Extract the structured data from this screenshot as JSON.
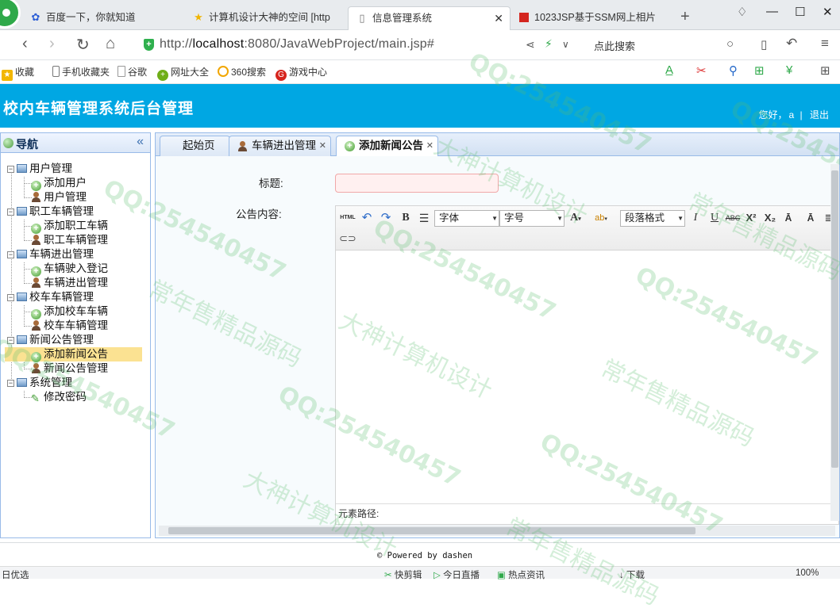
{
  "browser": {
    "tabs": [
      {
        "title": "百度一下，你就知道",
        "icon": "paw-icon"
      },
      {
        "title": "计算机设计大神的空间 [http",
        "icon": "star-icon"
      },
      {
        "title": "信息管理系统",
        "icon": "page-icon"
      },
      {
        "title": "1023JSP基于SSM网上相片",
        "icon": "red-square-icon"
      }
    ],
    "url_prefix": "http://",
    "url_host": "localhost",
    "url_rest": ":8080/JavaWebProject/main.jsp#",
    "search_label": "点此搜索",
    "bookmarks": [
      "收藏",
      "手机收藏夹",
      "谷歌",
      "网址大全",
      "360搜索",
      "游戏中心"
    ]
  },
  "app": {
    "title": "校内车辆管理系统后台管理",
    "greeting": "您好，",
    "user": "a",
    "separator": "|",
    "logout": "退出"
  },
  "nav": {
    "title": "导航",
    "collapse": "«",
    "groups": [
      {
        "label": "用户管理",
        "items": [
          "添加用户",
          "用户管理"
        ]
      },
      {
        "label": "职工车辆管理",
        "items": [
          "添加职工车辆",
          "职工车辆管理"
        ]
      },
      {
        "label": "车辆进出管理",
        "items": [
          "车辆驶入登记",
          "车辆进出管理"
        ]
      },
      {
        "label": "校车车辆管理",
        "items": [
          "添加校车车辆",
          "校车车辆管理"
        ]
      },
      {
        "label": "新闻公告管理",
        "items": [
          "添加新闻公告",
          "新闻公告管理"
        ]
      },
      {
        "label": "系统管理",
        "items": [
          "修改密码"
        ]
      }
    ]
  },
  "tabs": [
    {
      "label": "起始页",
      "closable": false
    },
    {
      "label": "车辆进出管理",
      "closable": true
    },
    {
      "label": "添加新闻公告",
      "closable": true,
      "active": true
    }
  ],
  "form": {
    "title_label": "标题:",
    "title_value": "",
    "content_label": "公告内容:",
    "editor": {
      "html_btn": "HTML",
      "font_family": "字体",
      "font_size": "字号",
      "paragraph": "段落格式",
      "path_label": "元素路径:"
    }
  },
  "footer": {
    "powered": "Powered by dashen"
  },
  "statusbar": {
    "left": "日优选",
    "items": [
      "快剪辑",
      "今日直播",
      "热点资讯",
      "下载"
    ],
    "zoom": "100%"
  },
  "watermark": {
    "qq": "QQ:254540457",
    "line1": "大神计算机设计",
    "line2": "常年售精品源码"
  },
  "colors": {
    "header": "#00a7e3",
    "selected": "#fbe292",
    "panel_border": "#99bbe8"
  }
}
